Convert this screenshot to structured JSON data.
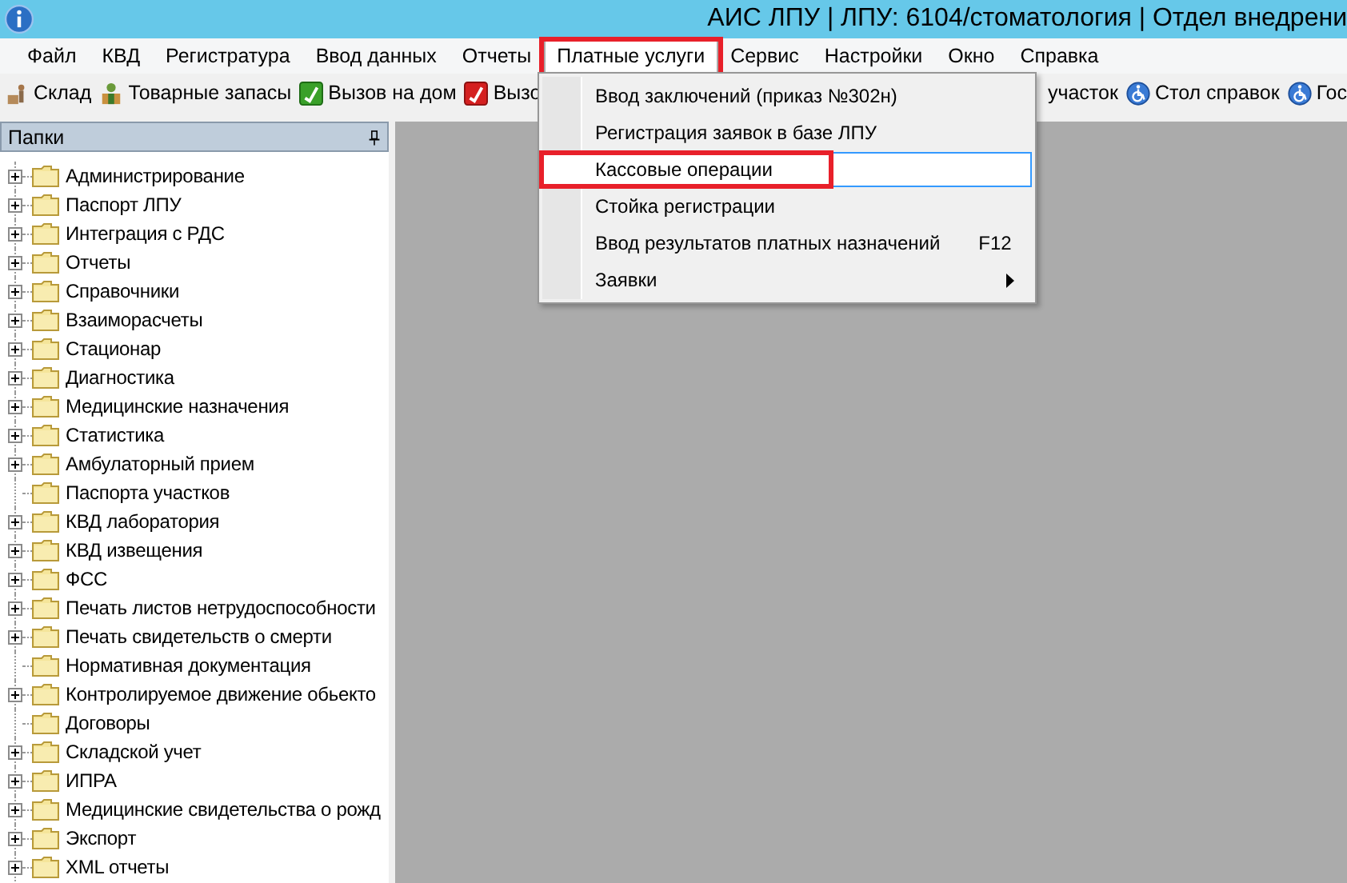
{
  "window": {
    "title": "АИС ЛПУ | ЛПУ: 6104/стоматология | Отдел внедрени"
  },
  "menu_bar": [
    {
      "label": "Файл",
      "open": false,
      "annotated": false
    },
    {
      "label": "КВД",
      "open": false,
      "annotated": false
    },
    {
      "label": "Регистратура",
      "open": false,
      "annotated": false
    },
    {
      "label": "Ввод данных",
      "open": false,
      "annotated": false
    },
    {
      "label": "Отчеты",
      "open": false,
      "annotated": false
    },
    {
      "label": "Платные услуги",
      "open": true,
      "annotated": true
    },
    {
      "label": "Сервис",
      "open": false,
      "annotated": false
    },
    {
      "label": "Настройки",
      "open": false,
      "annotated": false
    },
    {
      "label": "Окно",
      "open": false,
      "annotated": false
    },
    {
      "label": "Справка",
      "open": false,
      "annotated": false
    }
  ],
  "toolbar_left": [
    {
      "label": "Склад",
      "kind": "warehouse"
    },
    {
      "label": "Товарные запасы",
      "kind": "stock"
    },
    {
      "label": "Вызов на дом",
      "kind": "phone-green"
    },
    {
      "label": "Вызо",
      "kind": "phone-red"
    }
  ],
  "toolbar_right": [
    {
      "label": "участок",
      "kind": "none"
    },
    {
      "label": "Стол справок",
      "kind": "wheelchair"
    },
    {
      "label": "Гос",
      "kind": "wheelchair"
    }
  ],
  "dropdown": {
    "items": [
      {
        "label": "Ввод заключений (приказ №302н)",
        "selected": false,
        "annotated": false
      },
      {
        "label": "Регистрация заявок в базе ЛПУ",
        "selected": false,
        "annotated": false
      },
      {
        "label": "Кассовые операции",
        "selected": true,
        "annotated": true
      },
      {
        "label": "Стойка регистрации",
        "selected": false,
        "annotated": false
      },
      {
        "label": "Ввод результатов платных назначений",
        "shortcut": "F12",
        "selected": false,
        "annotated": false
      },
      {
        "label": "Заявки",
        "submenu": true,
        "selected": false,
        "annotated": false
      }
    ]
  },
  "folders_panel": {
    "title": "Папки",
    "items": [
      {
        "label": "Администрирование",
        "expandable": true
      },
      {
        "label": "Паспорт ЛПУ",
        "expandable": true
      },
      {
        "label": "Интеграция с РДС",
        "expandable": true
      },
      {
        "label": "Отчеты",
        "expandable": true
      },
      {
        "label": "Справочники",
        "expandable": true
      },
      {
        "label": "Взаиморасчеты",
        "expandable": true
      },
      {
        "label": "Стационар",
        "expandable": true
      },
      {
        "label": "Диагностика",
        "expandable": true
      },
      {
        "label": "Медицинские назначения",
        "expandable": true
      },
      {
        "label": "Статистика",
        "expandable": true
      },
      {
        "label": "Амбулаторный прием",
        "expandable": true
      },
      {
        "label": "Паспорта участков",
        "expandable": false
      },
      {
        "label": "КВД лаборатория",
        "expandable": true
      },
      {
        "label": "КВД извещения",
        "expandable": true
      },
      {
        "label": "ФСС",
        "expandable": true
      },
      {
        "label": "Печать листов нетрудоспособности",
        "expandable": true
      },
      {
        "label": "Печать свидетельств о смерти",
        "expandable": true
      },
      {
        "label": "Нормативная документация",
        "expandable": false
      },
      {
        "label": "Контролируемое движение обьекто",
        "expandable": true
      },
      {
        "label": "Договоры",
        "expandable": false
      },
      {
        "label": "Складской учет",
        "expandable": true
      },
      {
        "label": "ИПРА",
        "expandable": true
      },
      {
        "label": "Медицинские свидетельства о рожд",
        "expandable": true
      },
      {
        "label": "Экспорт",
        "expandable": true
      },
      {
        "label": "XML отчеты",
        "expandable": true
      }
    ]
  }
}
